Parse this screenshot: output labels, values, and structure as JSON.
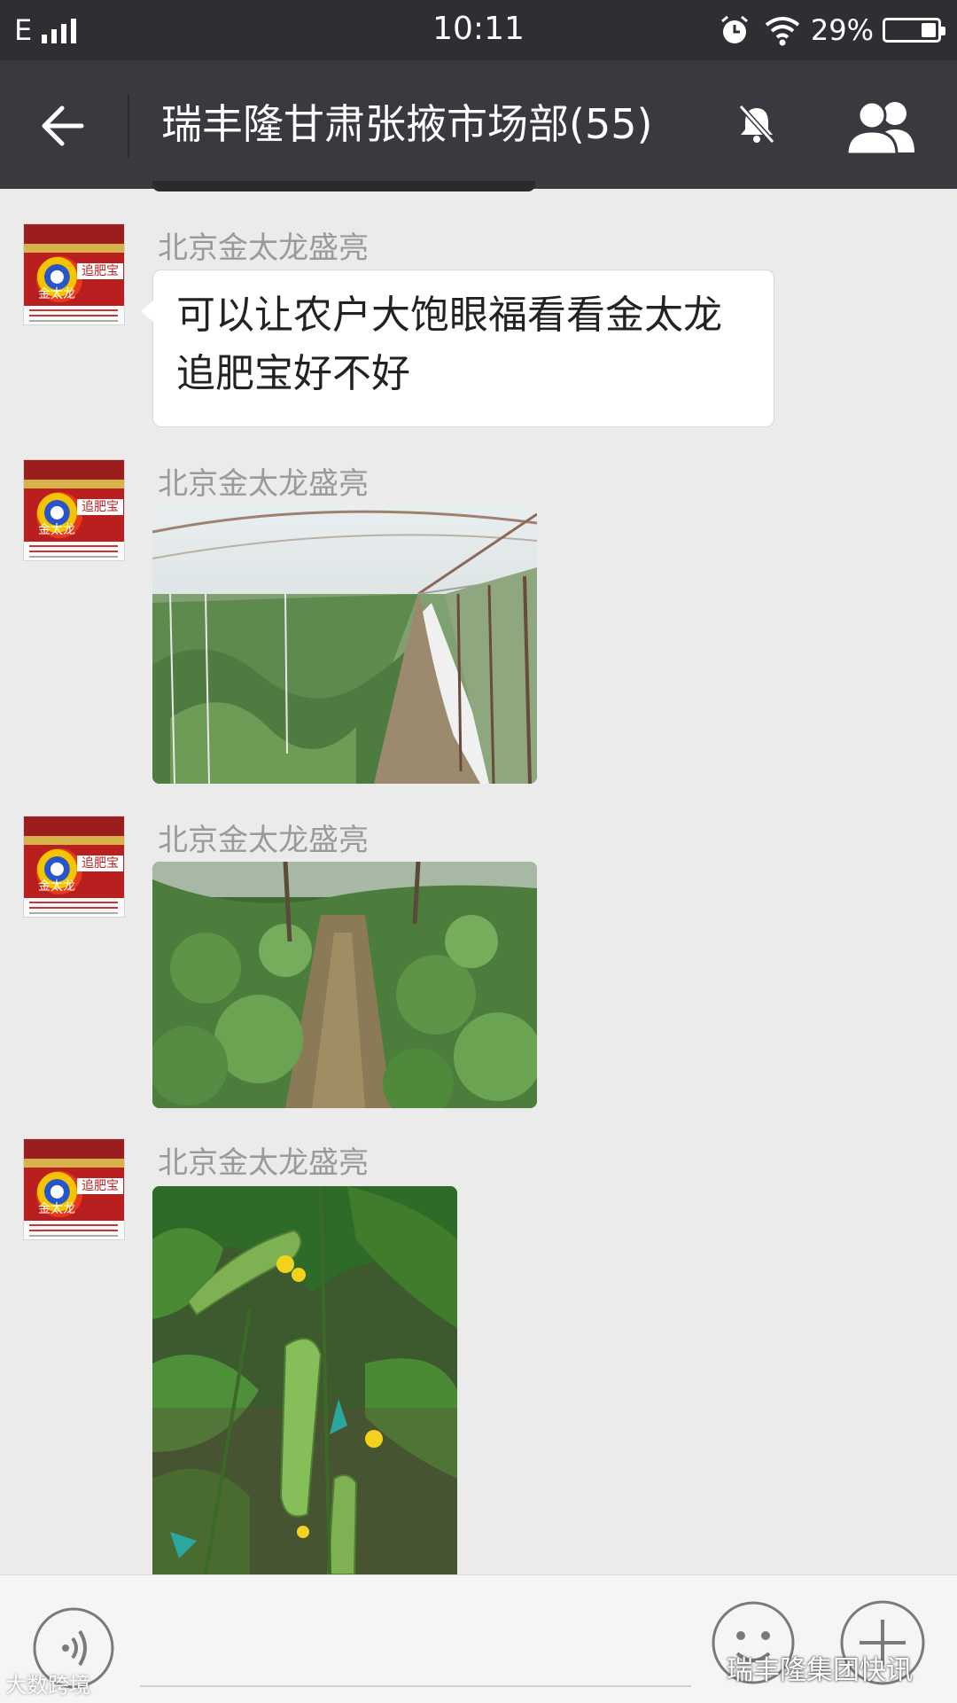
{
  "status_bar": {
    "network": "E",
    "time": "10:11",
    "battery_percent": "29%",
    "battery_level": 0.29,
    "icons": [
      "signal-icon",
      "alarm-icon",
      "wifi-icon",
      "battery-icon"
    ]
  },
  "header": {
    "title": "瑞丰隆甘肃张掖市场部(55)",
    "icons": [
      "back-arrow-icon",
      "mute-bell-icon",
      "group-members-icon"
    ]
  },
  "messages": [
    {
      "sender": "北京金太龙盛亮",
      "type": "text",
      "text": "可以让农户大饱眼福看看金太龙追肥宝好不好"
    },
    {
      "sender": "北京金太龙盛亮",
      "type": "image",
      "image": "greenhouse-cucumber-rows"
    },
    {
      "sender": "北京金太龙盛亮",
      "type": "image",
      "image": "cucumber-vine-path"
    },
    {
      "sender": "北京金太龙盛亮",
      "type": "image",
      "image": "cucumber-closeup"
    }
  ],
  "avatar": {
    "brand_text": "追肥宝",
    "logo_text": "金太龙"
  },
  "input_bar": {
    "icons": [
      "voice-icon",
      "emoji-icon",
      "plus-icon"
    ]
  },
  "watermarks": {
    "right": "瑞丰隆集团快讯",
    "left": "大数跨境"
  },
  "colors": {
    "status_bar_bg": "#2e2f33",
    "header_bg": "#393a3f",
    "chat_bg": "#ebebeb",
    "bubble_bg": "#ffffff"
  }
}
